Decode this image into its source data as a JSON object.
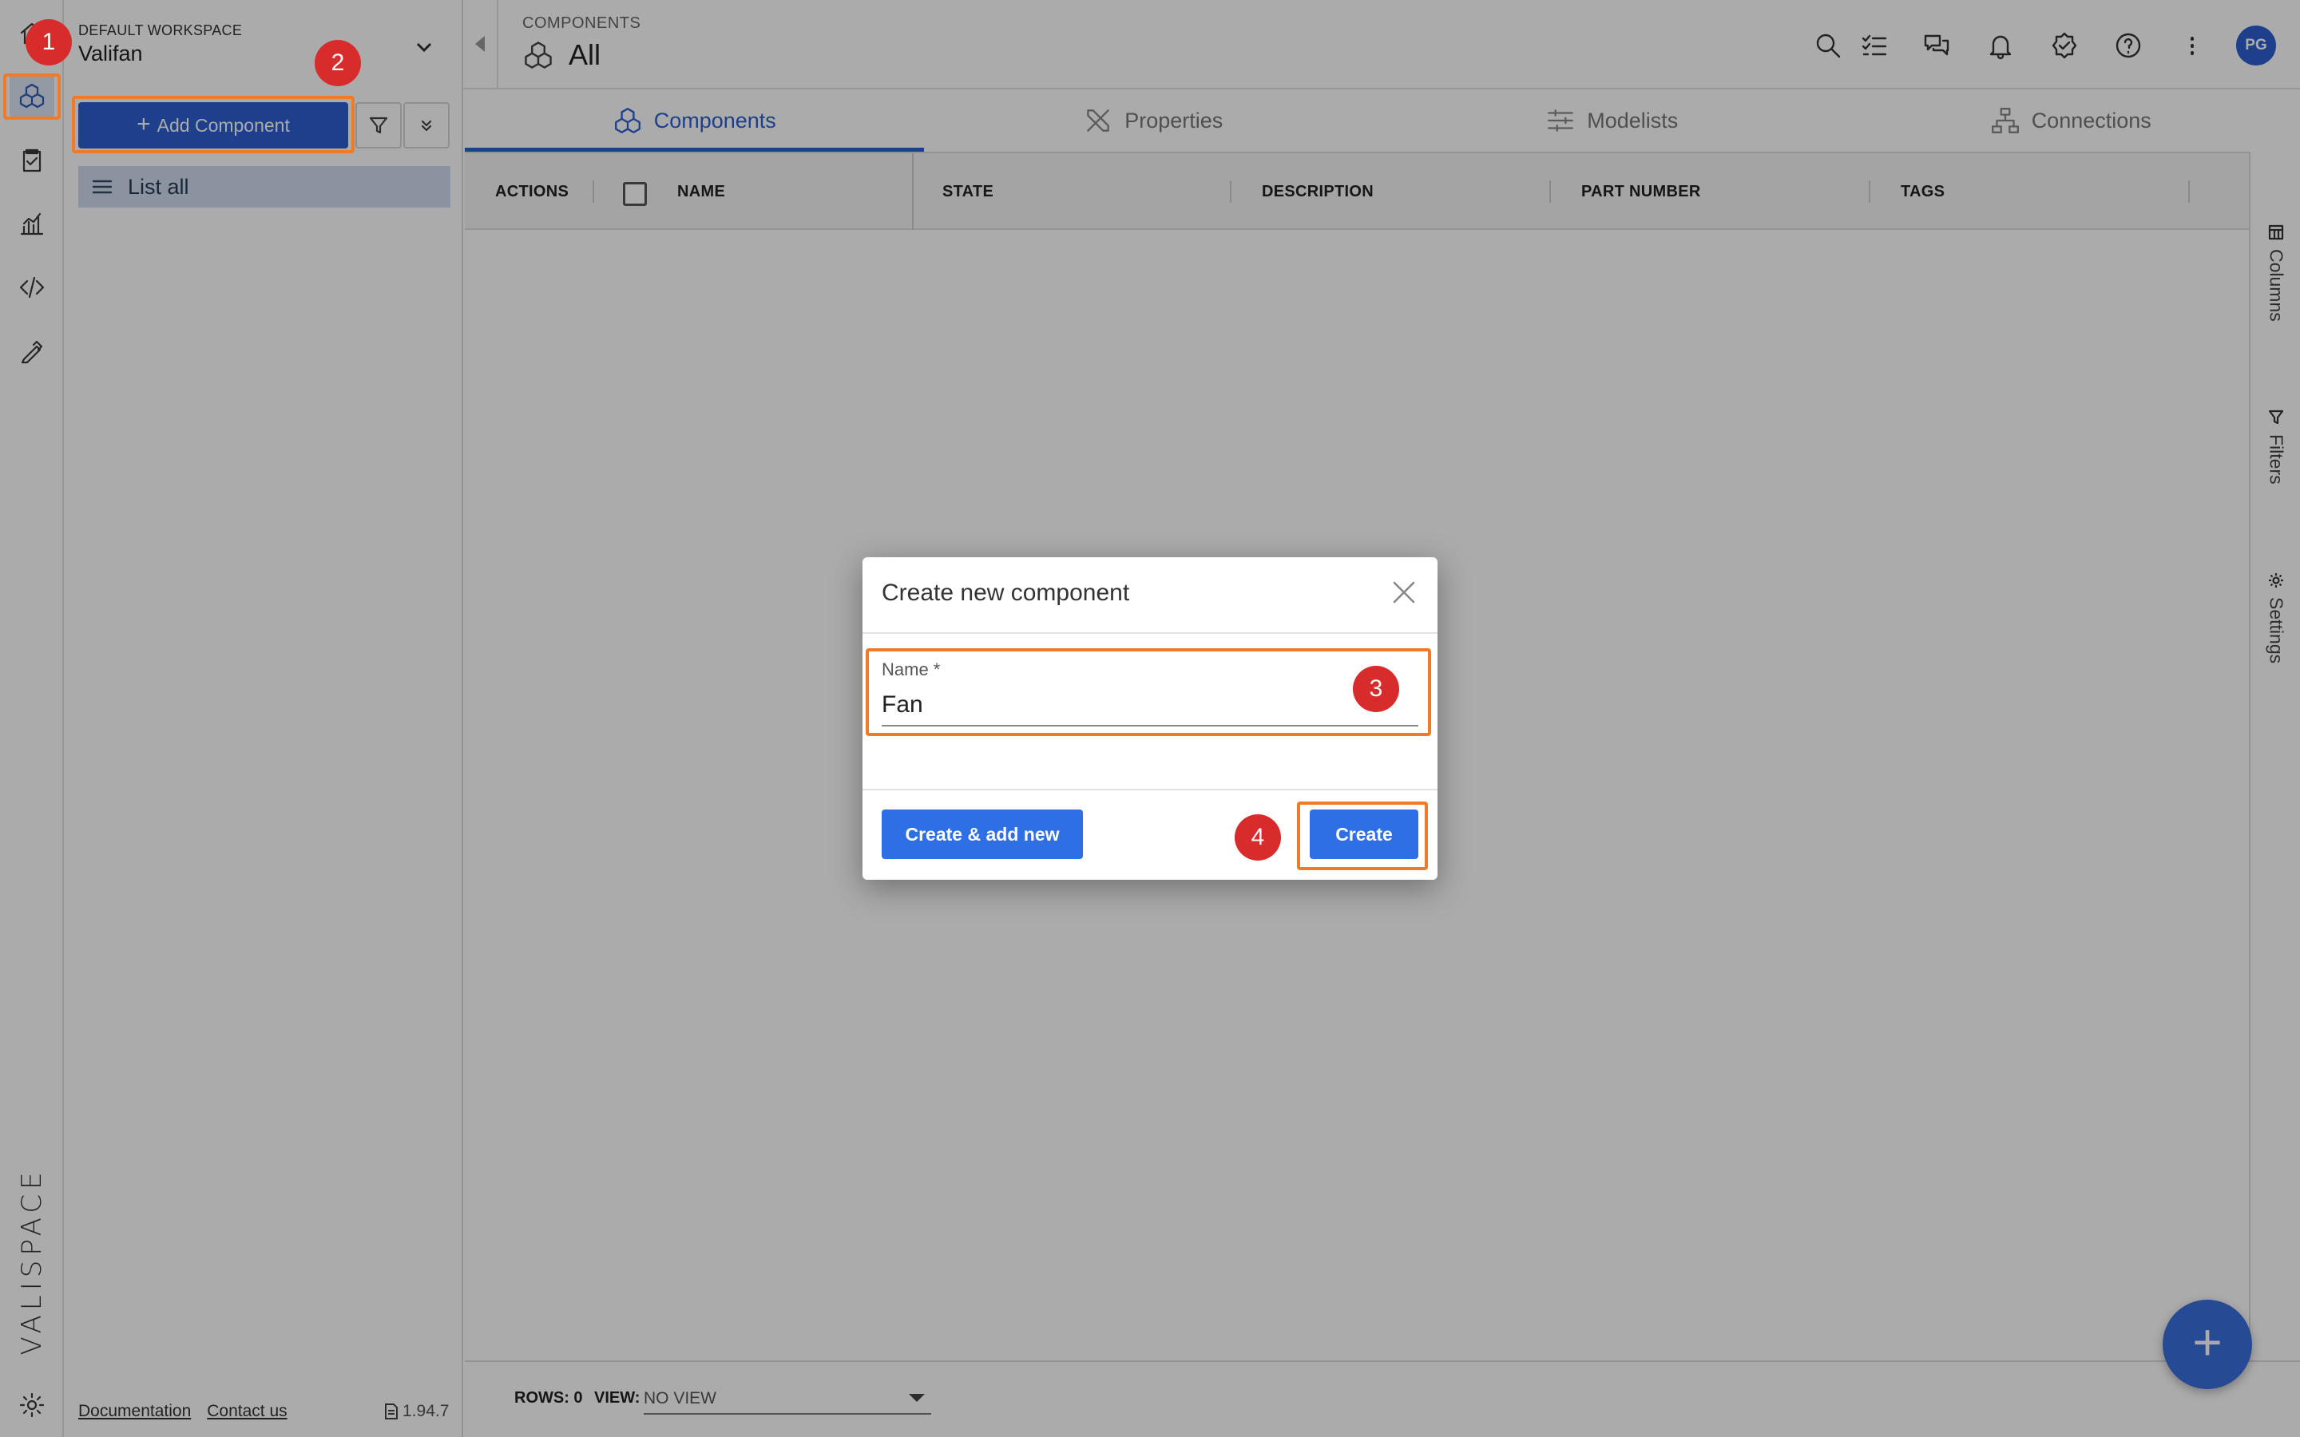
{
  "workspace": {
    "label": "DEFAULT WORKSPACE",
    "name": "Valifan"
  },
  "sidebar": {
    "add_button": "Add Component",
    "list_all": "List all"
  },
  "brand": "VALISPACE",
  "footer_links": {
    "documentation": "Documentation",
    "contact": "Contact us",
    "version": "1.94.7"
  },
  "header": {
    "breadcrumb": "COMPONENTS",
    "title": "All",
    "avatar": "PG"
  },
  "tabs": [
    {
      "label": "Components",
      "active": true
    },
    {
      "label": "Properties",
      "active": false
    },
    {
      "label": "Modelists",
      "active": false
    },
    {
      "label": "Connections",
      "active": false
    }
  ],
  "grid": {
    "columns": [
      "ACTIONS",
      "NAME",
      "STATE",
      "DESCRIPTION",
      "PART NUMBER",
      "TAGS"
    ]
  },
  "side_panel": {
    "columns": "Columns",
    "filters": "Filters",
    "settings": "Settings"
  },
  "statusbar": {
    "rows_label": "ROWS: 0",
    "view_label": "VIEW:",
    "view_value": "NO VIEW"
  },
  "modal": {
    "title": "Create new component",
    "name_label": "Name *",
    "name_value": "Fan",
    "create_add": "Create & add new",
    "create": "Create"
  },
  "annotations": [
    "1",
    "2",
    "3",
    "4"
  ],
  "colors": {
    "primary": "#2e5fd1",
    "highlight": "#f07a28",
    "marker": "#d82c2c"
  }
}
